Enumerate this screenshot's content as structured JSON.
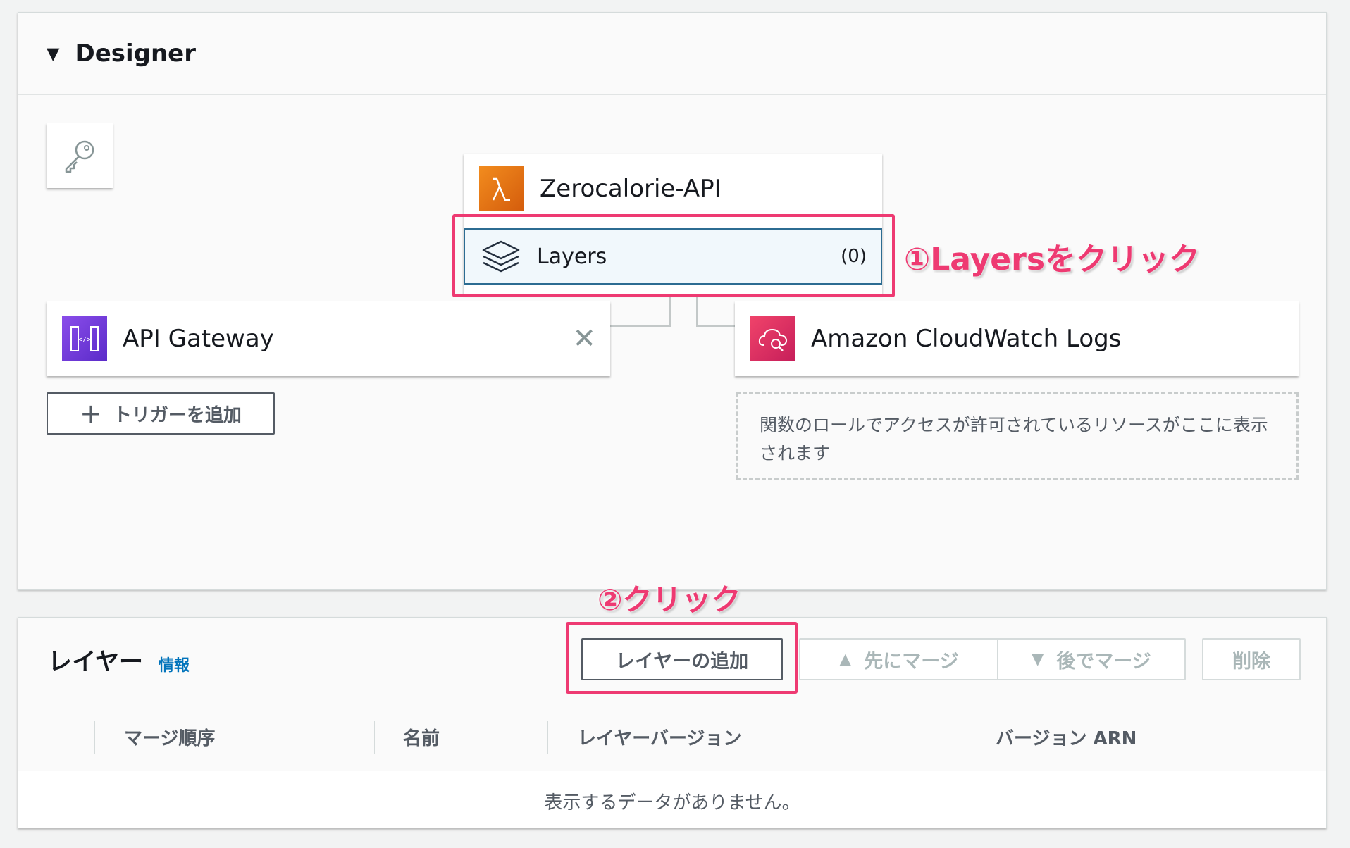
{
  "designer": {
    "title": "Designer",
    "function": {
      "name": "Zerocalorie-API"
    },
    "layers": {
      "label": "Layers",
      "count": "(0)"
    },
    "trigger": {
      "name": "API Gateway"
    },
    "destination": {
      "name": "Amazon CloudWatch Logs"
    },
    "add_trigger_label": "トリガーを追加",
    "resources_placeholder": "関数のロールでアクセスが許可されているリソースがここに表示されます"
  },
  "annotations": {
    "step1": "①Layersをクリック",
    "step2": "②クリック"
  },
  "layer_section": {
    "title": "レイヤー",
    "info_link": "情報",
    "buttons": {
      "add": "レイヤーの追加",
      "merge_first": "先にマージ",
      "merge_later": "後でマージ",
      "delete": "削除"
    },
    "columns": [
      "マージ順序",
      "名前",
      "レイヤーバージョン",
      "バージョン ARN"
    ],
    "empty_message": "表示するデータがありません。"
  },
  "colors": {
    "accent_pink": "#ee3a72",
    "link_blue": "#0073bb",
    "lambda_orange": "#f28c1e",
    "apigw_purple": "#7b3fe4",
    "cloudwatch_pink": "#e7157b"
  },
  "icons": [
    "key-icon",
    "lambda-icon",
    "layers-icon",
    "api-gateway-icon",
    "cloudwatch-icon",
    "close-icon",
    "plus-icon",
    "caret-down-icon",
    "triangle-up-icon",
    "triangle-down-icon"
  ]
}
